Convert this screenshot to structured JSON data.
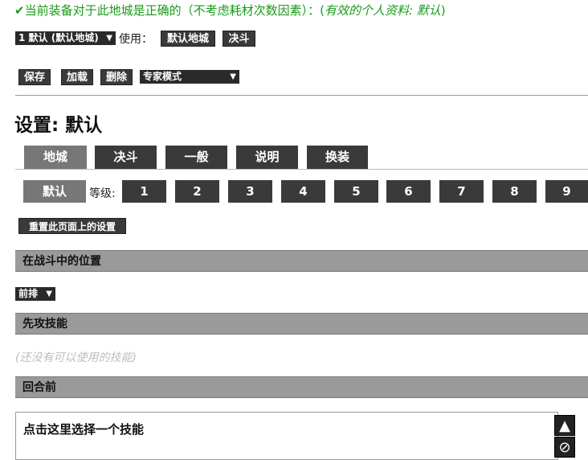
{
  "status": {
    "check": "✔",
    "text": "当前装备对于此地城是正确的（不考虑耗材次数因素）：(",
    "profile": "有效的个人资料: 默认",
    "close": ")"
  },
  "profile_select": {
    "value": "1 默认 (默认地城)",
    "arrow": "▼"
  },
  "use_label": "使用：",
  "use_buttons": [
    "默认地城",
    "决斗"
  ],
  "toolbar": {
    "save": "保存",
    "load": "加载",
    "delete": "删除",
    "mode": "专家模式",
    "mode_arrow": "▼"
  },
  "settings_title": "设置: 默认",
  "tabs": [
    "地城",
    "决斗",
    "一般",
    "说明",
    "换装"
  ],
  "level_row": {
    "default": "默认",
    "label": "等级:",
    "levels": [
      "1",
      "2",
      "3",
      "4",
      "5",
      "6",
      "7",
      "8",
      "9"
    ]
  },
  "reset_button": "重置此页面上的设置",
  "sections": {
    "position": "在战斗中的位置",
    "position_value": "前排",
    "position_arrow": "▼",
    "first_strike": "先攻技能",
    "first_strike_empty": "(还没有可以使用的技能)",
    "before_round": "回合前",
    "skill_prompt": "点击这里选择一个技能"
  },
  "side_buttons": {
    "up": "▲",
    "none": "⊘"
  },
  "colors": {
    "status_green": "#1a9a1a",
    "dark_button": "#3a3a3a",
    "active_tab": "#777777",
    "section_bg": "#9a9a9a"
  }
}
